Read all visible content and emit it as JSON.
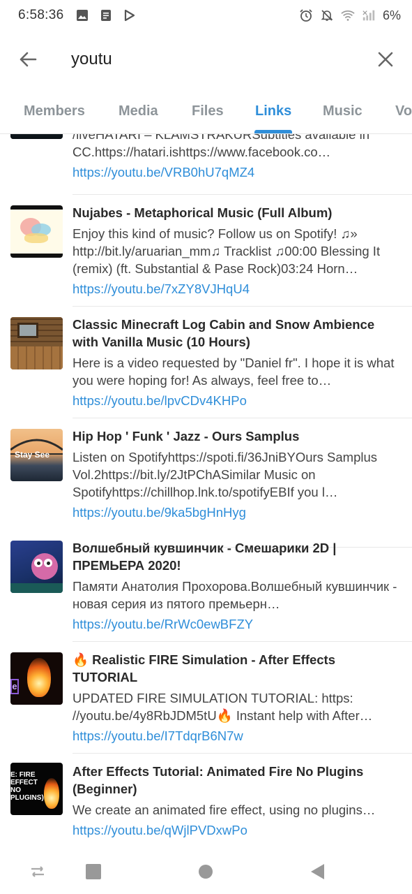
{
  "status_bar": {
    "time": "6:58:36",
    "battery": "6%",
    "left_icons": [
      "image-icon",
      "document-icon",
      "play-icon"
    ],
    "right_icons": [
      "alarm-icon",
      "mute-icon",
      "wifi-icon",
      "signal-icon"
    ]
  },
  "search": {
    "value": "youtu"
  },
  "tabs": [
    {
      "label": "Members",
      "active": false
    },
    {
      "label": "Media",
      "active": false
    },
    {
      "label": "Files",
      "active": false
    },
    {
      "label": "Links",
      "active": true
    },
    {
      "label": "Music",
      "active": false
    },
    {
      "label": "Vo",
      "active": false
    }
  ],
  "items": [
    {
      "title": "",
      "description": "/liveHATARI – KLAMSTRAKURSubtitles available in CC.https://hatari.ishttps://www.facebook.co…",
      "url": "https://youtu.be/VRB0hU7qMZ4"
    },
    {
      "title": "Nujabes - Metaphorical Music (Full Album)",
      "description": "Enjoy this kind of music? Follow us on Spotify! ♫» http://bit.ly/aruarian_mm♫ Tracklist ♫00:00 Blessing It (remix) (ft. Substantial & Pase Rock)03:24 Horn…",
      "url": "https://youtu.be/7xZY8VJHqU4"
    },
    {
      "title": "Classic Minecraft Log Cabin and Snow Ambience with Vanilla Music (10 Hours)",
      "description": "Here is a video requested by \"Daniel fr\". I hope it is what you were hoping for! As always, feel free to…",
      "url": "https://youtu.be/lpvCDv4KHPo"
    },
    {
      "title": "Hip Hop ' Funk ' Jazz - Ours Samplus",
      "description": "Listen on Spotifyhttps://spoti.fi/36JniBYOurs Samplus Vol.2https://bit.ly/2JtPChASimilar Music on Spotifyhttps://chillhop.lnk.to/spotifyEBIf you l…",
      "url": "https://youtu.be/9ka5bgHnHyg",
      "thumb_text": "Stay See"
    },
    {
      "title": "Волшебный кувшинчик - Смешарики 2D | ПРЕМЬЕРА 2020!",
      "description": "Памяти Анатолия Прохорова.Волшебный кувшинчик - новая серия из пятого премьерн…",
      "url": "https://youtu.be/RrWc0ewBFZY"
    },
    {
      "title": "🔥 Realistic FIRE Simulation - After Effects TUTORIAL",
      "description": "UPDATED FIRE SIMULATION TUTORIAL: https: //youtu.be/4y8RbJDM5tU🔥 Instant help with After…",
      "url": "https://youtu.be/I7TdqrB6N7w",
      "thumb_text": "e"
    },
    {
      "title": "After Effects Tutorial: Animated Fire No Plugins (Beginner)",
      "description": "We create an animated fire effect, using no plugins…",
      "url": "https://youtu.be/qWjlPVDxwPo",
      "thumb_text": "E: FIRE EFFECT NO PLUGINS)"
    }
  ],
  "nav": [
    "recent-apps-icon",
    "home-icon",
    "back-icon"
  ]
}
